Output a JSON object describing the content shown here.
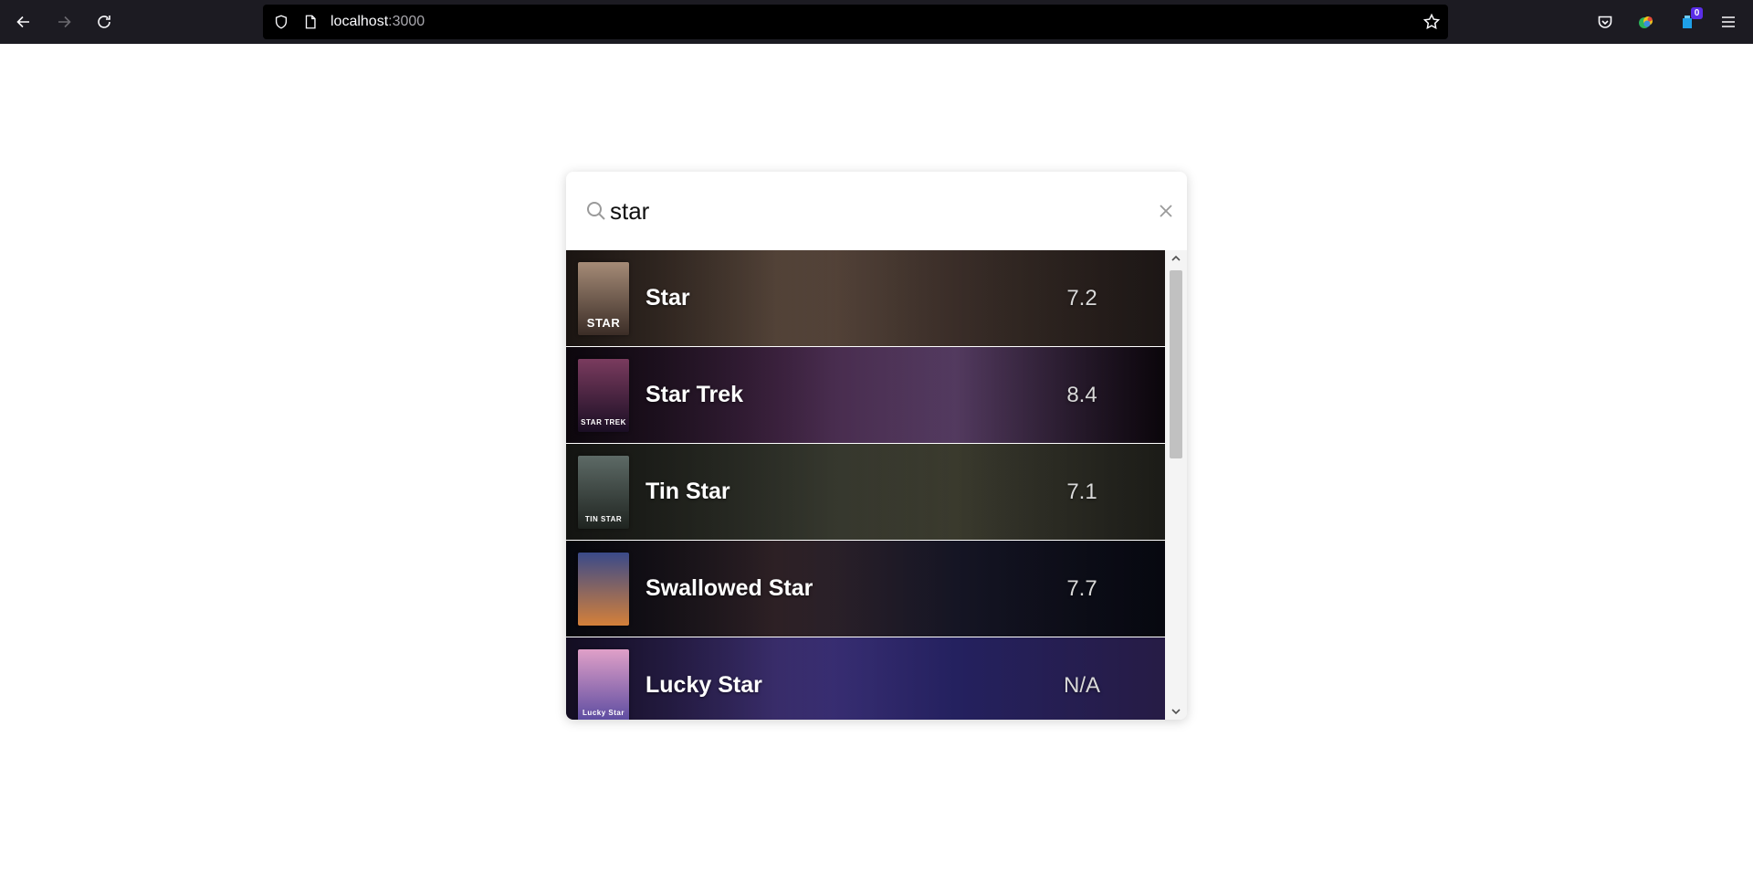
{
  "browser": {
    "url_host": "localhost",
    "url_port": ":3000",
    "extension_badge": "0"
  },
  "search": {
    "value": "star",
    "placeholder": ""
  },
  "results": [
    {
      "title": "Star",
      "rating": "7.2",
      "poster_text": "STAR",
      "colors": [
        "#3a2d27",
        "#6b5648",
        "#4a3a33",
        "#2b2220"
      ],
      "poster_colors": [
        "#a58b77",
        "#3b2d27"
      ]
    },
    {
      "title": "Star Trek",
      "rating": "8.4",
      "poster_text": "STAR TREK",
      "colors": [
        "#1b0f1c",
        "#4b2a4e",
        "#6a4a7a",
        "#100810"
      ],
      "poster_colors": [
        "#7a3b5e",
        "#1a0e24"
      ]
    },
    {
      "title": "Tin Star",
      "rating": "7.1",
      "poster_text": "TIN STAR",
      "colors": [
        "#2a2c26",
        "#3a3d33",
        "#4a4a3a",
        "#2a2a24"
      ],
      "poster_colors": [
        "#5d6a66",
        "#1f2420"
      ]
    },
    {
      "title": "Swallowed Star",
      "rating": "7.7",
      "poster_text": "",
      "colors": [
        "#0d0f1c",
        "#3b2a30",
        "#1b1b2e",
        "#0a0c18"
      ],
      "poster_colors": [
        "#3a4a8a",
        "#d4803a"
      ]
    },
    {
      "title": "Lucky Star",
      "rating": "N/A",
      "poster_text": "Lucky Star",
      "colors": [
        "#2a1d4a",
        "#4a3a8a",
        "#2e2a7a",
        "#3a2a6a"
      ],
      "poster_colors": [
        "#e0a0c8",
        "#5a4aa0"
      ]
    }
  ],
  "icons": {
    "back": "arrow-left-icon",
    "forward": "arrow-right-icon",
    "reload": "reload-icon",
    "shield": "shield-icon",
    "page": "page-icon",
    "bookmark": "star-outline-icon",
    "pocket": "pocket-icon",
    "extension1": "colorful-extension-icon",
    "extension2": "extension-badge-icon",
    "menu": "hamburger-menu-icon",
    "search": "magnifier-icon",
    "clear": "close-icon"
  }
}
